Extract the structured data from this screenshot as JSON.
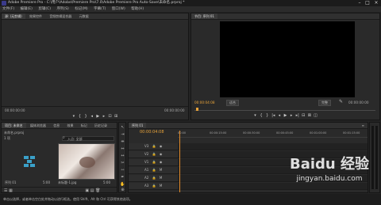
{
  "window": {
    "title": "Adobe Premiere Pro - C:\\用户\\Adobe\\Premiere Pro\\7.0\\Adobe Premiere Pro Auto-Save\\未命名.prproj *"
  },
  "menu": [
    "文件(F)",
    "编辑(E)",
    "剪辑(C)",
    "序列(S)",
    "标记(M)",
    "字幕(T)",
    "窗口(W)",
    "帮助(H)"
  ],
  "source_panel": {
    "tabs": [
      "源: (无剪辑)",
      "效果控件",
      "音频剪辑混合器",
      "元数据"
    ],
    "time_left": "00:00:00:00",
    "time_right": "00:00:00:00"
  },
  "program_panel": {
    "tab": "节目: 序列 01",
    "time_left": "00:00:04:08",
    "fit_label": "适合",
    "quality_label": "完整",
    "time_right": "00:00:00:00"
  },
  "project_panel": {
    "tabs": [
      "项目: 未命名",
      "媒体浏览器",
      "信息",
      "效果",
      "标记",
      "历史记录"
    ],
    "project_file": "未命名.prproj",
    "item_count": "1 项",
    "search_label": "入点: 全部",
    "clips": [
      {
        "name": "序列 01",
        "duration": "5:00"
      },
      {
        "name": "未标题-1.jpg",
        "duration": "5:00"
      }
    ]
  },
  "timeline": {
    "tab": "序列 01",
    "timecode": "00:00:04:08",
    "ruler": [
      "00:00",
      "00:00:15:00",
      "00:00:30:00",
      "00:00:45:00",
      "00:01:00:00",
      "00:01:15:00"
    ],
    "tracks": [
      {
        "label": "V3"
      },
      {
        "label": "V2"
      },
      {
        "label": "V1"
      },
      {
        "label": "A1"
      },
      {
        "label": "A2"
      },
      {
        "label": "A3"
      }
    ]
  },
  "meters": {
    "scale": [
      "0",
      "-6",
      "-12",
      "-18",
      "-24",
      "-30",
      "-36",
      "-42",
      "-48",
      "-54",
      "dB"
    ]
  },
  "status_bar": {
    "text": "单击以选择，或者单击空白处并拖动以进行框选。使用 Shift、Alt 和 Ctrl 可获得其他选项。"
  },
  "watermark": {
    "brand": "Baidu 经验",
    "url": "jingyan.baidu.com"
  },
  "colors": {
    "accent": "#e8a33a",
    "panel": "#2a2a2a",
    "background": "#232323",
    "playhead": "#e08a2a"
  },
  "icons": [
    "close-icon",
    "minimize-icon",
    "maximize-icon",
    "play-icon",
    "step-back-icon",
    "step-forward-icon",
    "marker-icon",
    "wrench-icon",
    "search-icon",
    "selection-tool-icon",
    "razor-tool-icon",
    "hand-tool-icon",
    "zoom-tool-icon",
    "eye-icon",
    "lock-icon",
    "speaker-icon"
  ]
}
